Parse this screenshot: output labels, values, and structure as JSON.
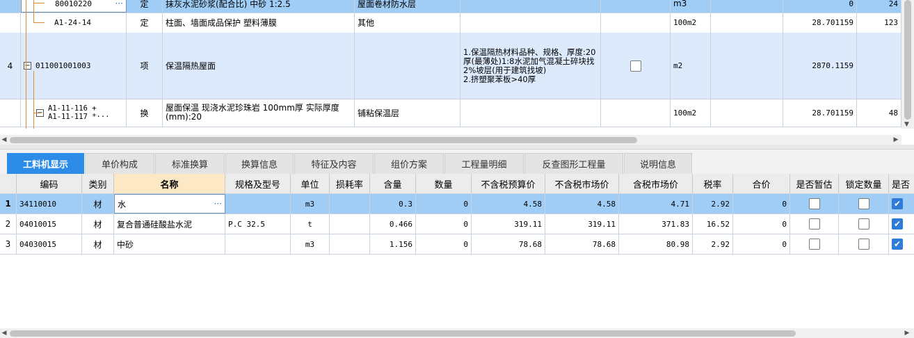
{
  "top_grid": {
    "rows": [
      {
        "no": "",
        "code": "80010220",
        "type": "定",
        "name": "抹灰水泥砂浆(配合比) 中砂 1:2.5",
        "category": "屋面卷材防水层",
        "features": "",
        "unit": "m3",
        "qty": "0",
        "price": "24"
      },
      {
        "no": "",
        "code": "A1-24-14",
        "type": "定",
        "name": "柱面、墙面成品保护 塑料薄膜",
        "category": "其他",
        "features": "",
        "unit": "100m2",
        "qty": "28.701159",
        "price": "123"
      },
      {
        "no": "4",
        "code": "011001001003",
        "type": "项",
        "name": "保温隔热屋面",
        "category": "",
        "features": "1.保温隔热材料品种、规格、厚度:20厚(最薄处)1:8水泥加气混凝土碎块找2%坡层(用于建筑找坡)\n2.挤塑聚苯板>40厚",
        "unit": "m2",
        "qty": "2870.1159",
        "price": ""
      },
      {
        "no": "",
        "code": "A1-11-116 +\nA1-11-117 *···",
        "type": "换",
        "name": "屋面保温 现浇水泥珍珠岩 100mm厚 实际厚度(mm):20",
        "category": "铺粘保温层",
        "features": "",
        "unit": "100m2",
        "qty": "28.701159",
        "price": "48"
      }
    ],
    "ellipsis": "···"
  },
  "tabs": [
    "工料机显示",
    "单价构成",
    "标准换算",
    "换算信息",
    "特征及内容",
    "组价方案",
    "工程量明细",
    "反查图形工程量",
    "说明信息"
  ],
  "active_tab": 0,
  "bottom_grid": {
    "columns": [
      "编码",
      "类别",
      "名称",
      "规格及型号",
      "单位",
      "损耗率",
      "含量",
      "数量",
      "不含税预算价",
      "不含税市场价",
      "含税市场价",
      "税率",
      "合价",
      "是否暂估",
      "锁定数量",
      "是否"
    ],
    "rows": [
      {
        "no": "1",
        "code": "34110010",
        "type": "材",
        "name": "水",
        "spec": "",
        "unit": "m3",
        "loss": "",
        "content": "0.3",
        "qty": "0",
        "budget": "4.58",
        "market": "4.58",
        "market_tax": "4.71",
        "tax": "2.92",
        "total": "0"
      },
      {
        "no": "2",
        "code": "04010015",
        "type": "材",
        "name": "复合普通硅酸盐水泥",
        "spec": "P.C 32.5",
        "unit": "t",
        "loss": "",
        "content": "0.466",
        "qty": "0",
        "budget": "319.11",
        "market": "319.11",
        "market_tax": "371.83",
        "tax": "16.52",
        "total": "0"
      },
      {
        "no": "3",
        "code": "04030015",
        "type": "材",
        "name": "中砂",
        "spec": "",
        "unit": "m3",
        "loss": "",
        "content": "1.156",
        "qty": "0",
        "budget": "78.68",
        "market": "78.68",
        "market_tax": "80.98",
        "tax": "2.92",
        "total": "0"
      }
    ],
    "ellipsis": "···"
  },
  "colors": {
    "selected_row": "#9fcdf6",
    "item_row": "#dceafc",
    "active_tab": "#2d8ce8",
    "tree_line": "#d98d3a"
  }
}
